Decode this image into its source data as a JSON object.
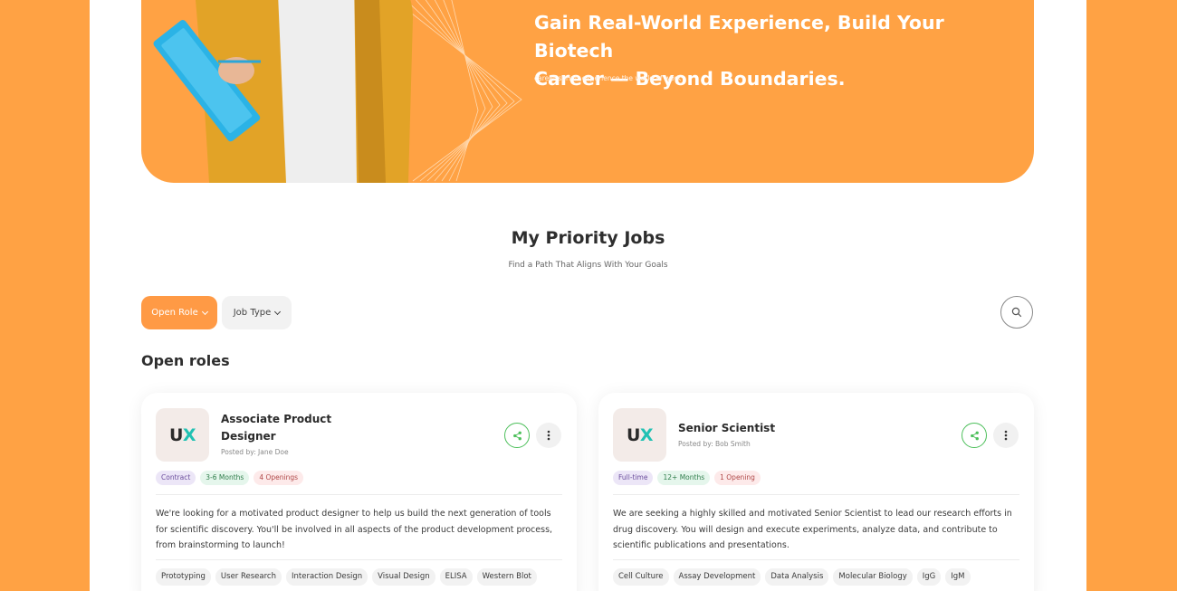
{
  "colors": {
    "accent": "#FFA244",
    "button_orange": "#FF9A45",
    "share_green": "#4cbf5a",
    "logo_teal": "#21c1b3"
  },
  "hero": {
    "title": "Gain Real-World Experience, Build Your Biotech\nCareer — Beyond Boundaries.",
    "subtitle": "career sprint: experience the world of work"
  },
  "section": {
    "title": "My Priority Jobs",
    "subtitle": "Find a Path That Aligns With Your Goals"
  },
  "filters": {
    "open_role": "Open Role",
    "job_type": "Job Type"
  },
  "icons": {
    "search": "search-icon",
    "share": "share-icon",
    "more": "more-vertical-icon",
    "chevron": "chevron-down-icon"
  },
  "open_roles_heading": "Open roles",
  "jobs": [
    {
      "logo_text": "U",
      "logo_accent": "X",
      "title": "Associate Product Designer",
      "posted_by": "Posted by: Jane Doe",
      "badges": [
        "Contract",
        "3-6 Months",
        "4 Openings"
      ],
      "description": "We're looking for a motivated product designer to help us build the next generation of tools for scientific discovery. You'll be involved in all aspects of the product development process, from brainstorming to launch!",
      "skills": [
        "Prototyping",
        "User Research",
        "Interaction Design",
        "Visual Design",
        "ELISA",
        "Western Blot"
      ]
    },
    {
      "logo_text": "U",
      "logo_accent": "X",
      "title": "Senior Scientist",
      "posted_by": "Posted by: Bob Smith",
      "badges": [
        "Full-time",
        "12+ Months",
        "1 Opening"
      ],
      "description": "We are seeking a highly skilled and motivated Senior Scientist to lead our research efforts in drug discovery. You will design and execute experiments, analyze data, and contribute to scientific publications and presentations.",
      "skills": [
        "Cell Culture",
        "Assay Development",
        "Data Analysis",
        "Molecular Biology",
        "IgG",
        "IgM"
      ]
    }
  ]
}
